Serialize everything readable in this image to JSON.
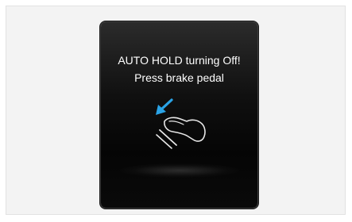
{
  "message": {
    "line1": "AUTO HOLD turning Off!",
    "line2": "Press brake pedal"
  },
  "icons": {
    "pedal": "foot-on-brake-pedal-icon",
    "arrow": "press-arrow-icon"
  },
  "colors": {
    "display_background": "#0b0b0b",
    "text": "#ffffff",
    "arrow": "#2aa3e6",
    "icon_outline": "#e6e6e6"
  }
}
